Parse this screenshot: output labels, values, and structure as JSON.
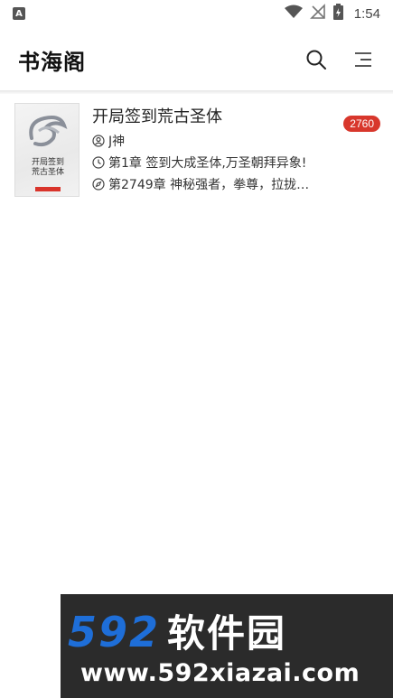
{
  "status_bar": {
    "notification_icon_letter": "A",
    "time": "1:54"
  },
  "app_bar": {
    "title": "书海阁"
  },
  "books": [
    {
      "title": "开局签到荒古圣体",
      "author": "J神",
      "first_chapter": "第1章 签到大成圣体,万圣朝拜异象!",
      "latest_chapter": "第2749章 神秘强者，拳尊，拉拢…",
      "count": "2760",
      "cover_title_line1": "开局签到",
      "cover_title_line2": "荒古圣体"
    }
  ],
  "watermark": {
    "number": "592",
    "name": "软件园",
    "url": "www.592xiazai.com"
  },
  "colors": {
    "badge": "#d8372c",
    "watermark_blue": "#1e6ed8",
    "watermark_bg": "#2b2b2b"
  },
  "icons": [
    "notification-icon",
    "wifi-icon",
    "signal-off-icon",
    "battery-charging-icon",
    "search-icon",
    "menu-icon",
    "author-icon",
    "clock-icon",
    "compass-icon"
  ]
}
